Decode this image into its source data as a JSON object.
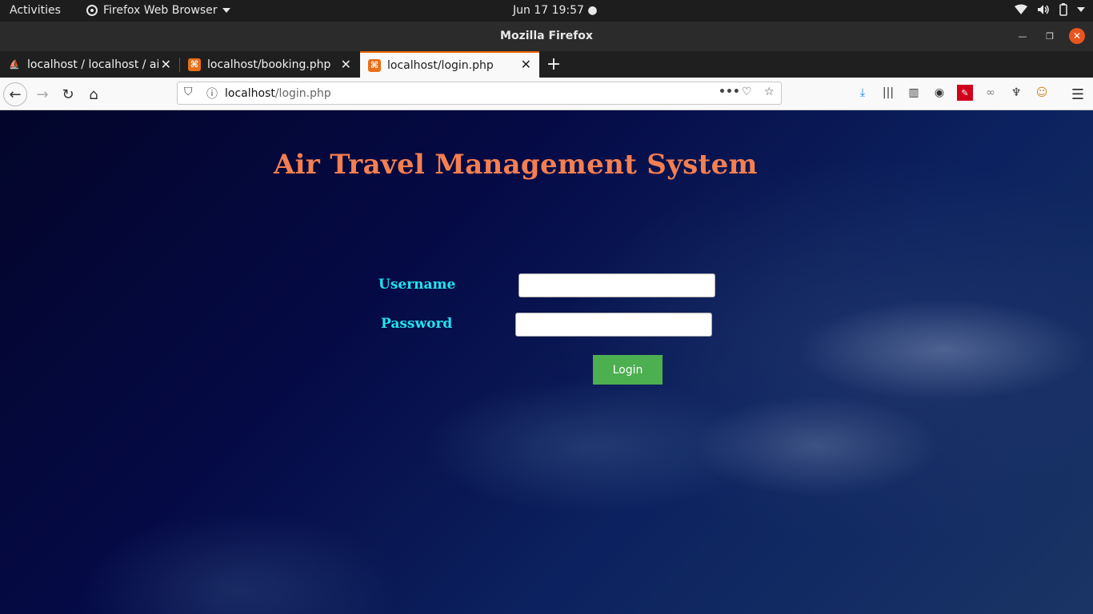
{
  "topbar": {
    "activities": "Activities",
    "app_menu": "Firefox Web Browser",
    "clock": "Jun 17  19:57"
  },
  "window": {
    "title": "Mozilla Firefox"
  },
  "tabs": [
    {
      "label": "localhost / localhost / air",
      "icon": "phpmyadmin-icon"
    },
    {
      "label": "localhost/booking.php",
      "icon": "xampp-icon"
    },
    {
      "label": "localhost/login.php",
      "icon": "xampp-icon",
      "active": true
    }
  ],
  "urlbar": {
    "host": "localhost",
    "path": "/login.php"
  },
  "page": {
    "heading": "Air Travel Management System",
    "username_label": "Username",
    "password_label": "Password",
    "username_value": "",
    "password_value": "",
    "login_button": "Login"
  },
  "colors": {
    "heading": "#f47f50",
    "labels": "#1fe4f0",
    "button": "#4caf50",
    "tab_accent": "#e66000"
  }
}
